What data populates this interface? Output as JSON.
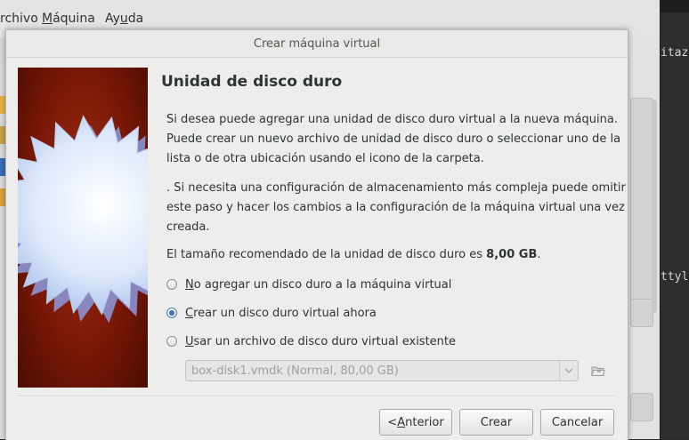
{
  "background_app": {
    "menu": [
      {
        "prefix": "",
        "mnemonic": "",
        "rest": "rchivo"
      },
      {
        "prefix": "",
        "mnemonic": "M",
        "rest": "áquina"
      },
      {
        "prefix": "Ay",
        "mnemonic": "u",
        "rest": "da"
      }
    ]
  },
  "terminal": {
    "lines": [
      "itaz",
      "ttyl"
    ]
  },
  "dialog": {
    "title": "Crear máquina virtual",
    "heading": "Unidad de disco duro",
    "paragraph1": [
      "Si desea puede agregar una unidad de disco duro virtual a la nueva máquina.",
      "Puede crear un nuevo archivo de unidad de disco duro o seleccionar uno de la",
      "lista o de otra ubicación usando el icono de la carpeta."
    ],
    "paragraph2": [
      ". Si necesita una configuración de almacenamiento más compleja puede omitir",
      "este paso y hacer los cambios a la configuración de la máquina virtual una vez",
      "creada."
    ],
    "recommended": {
      "text": "El tamaño recomendado de la unidad de disco duro es ",
      "size": "8,00 GB",
      "suffix": "."
    },
    "options": [
      {
        "mnemonic": "N",
        "rest": "o agregar un disco duro a la máquina virtual",
        "checked": false
      },
      {
        "mnemonic": "C",
        "rest": "rear un disco duro virtual ahora",
        "checked": true
      },
      {
        "mnemonic": "U",
        "rest": "sar un archivo de disco duro virtual existente",
        "checked": false
      }
    ],
    "disk_combo": {
      "value": "box-disk1.vmdk (Normal, 80,00 GB)",
      "enabled": false
    },
    "icons": {
      "combo_arrow": "chevron-down-icon",
      "folder": "folder-open-icon"
    },
    "buttons": {
      "back": {
        "prefix": "< ",
        "mnemonic": "A",
        "rest": "nterior"
      },
      "create": "Crear",
      "cancel": "Cancelar"
    },
    "colors": {
      "accent": "#3c74c4",
      "side_image_red": "#7a1806",
      "star_blue": "#dce8fb"
    }
  }
}
